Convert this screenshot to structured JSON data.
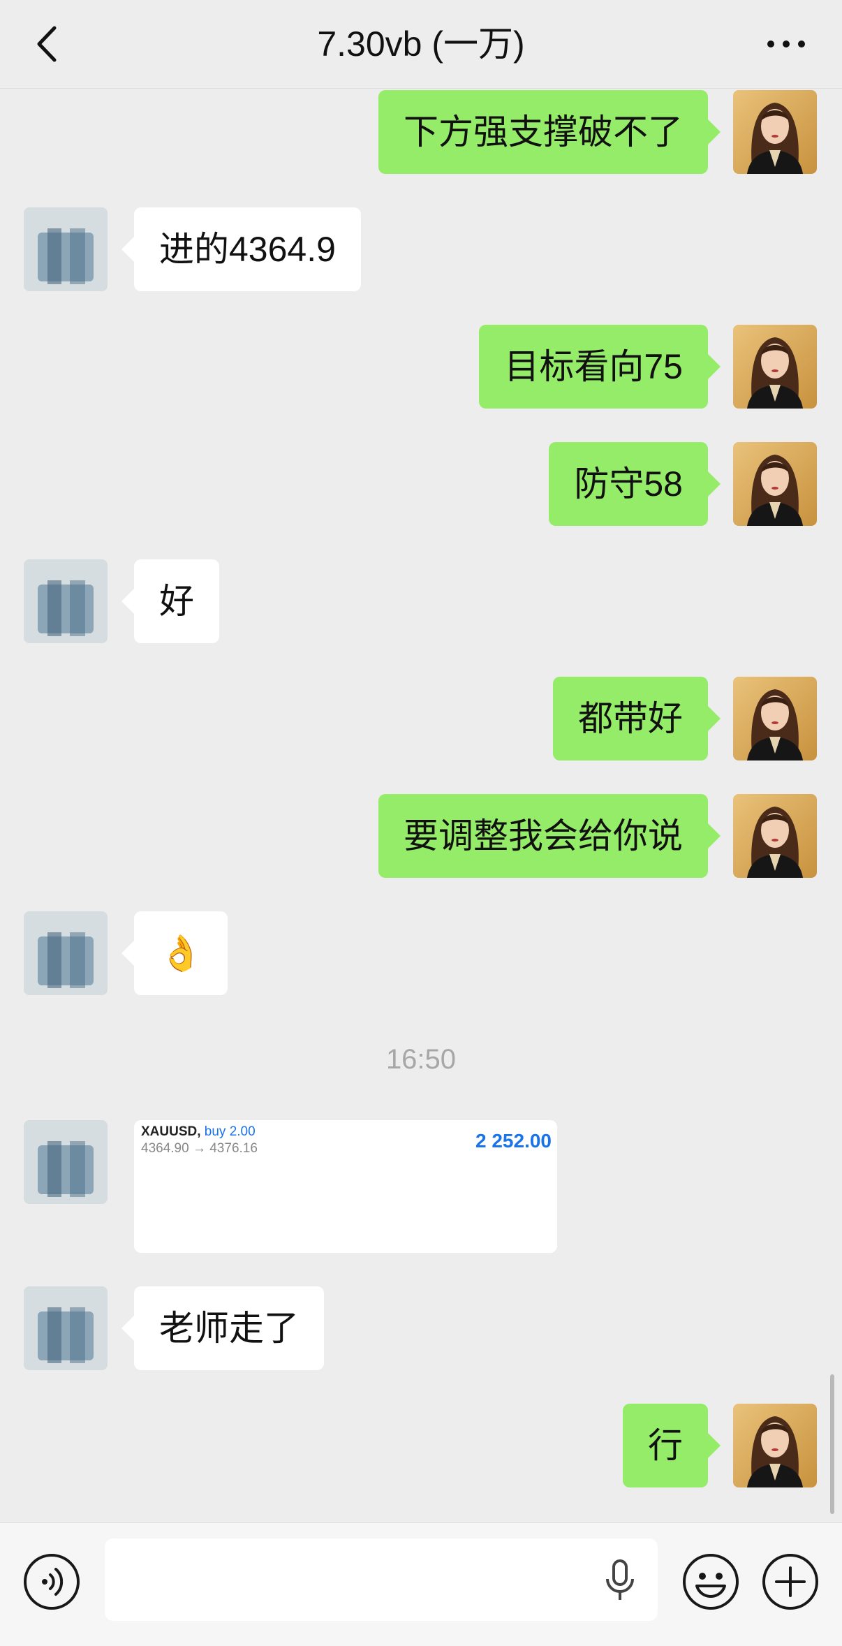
{
  "header": {
    "title": "7.30vb (一万)",
    "back_icon": "chevron-left-icon",
    "more_icon": "more-dots-icon"
  },
  "colors": {
    "background": "#ededed",
    "my_bubble": "#95ec69",
    "their_bubble": "#ffffff",
    "accent_blue": "#1a73e8",
    "timestamp": "#a7a7a7"
  },
  "messages": [
    {
      "side": "me",
      "text": "下方强支撑破不了"
    },
    {
      "side": "other",
      "text": "进的4364.9"
    },
    {
      "side": "me",
      "text": "目标看向75"
    },
    {
      "side": "me",
      "text": "防守58"
    },
    {
      "side": "other",
      "text": "好"
    },
    {
      "side": "me",
      "text": "都带好"
    },
    {
      "side": "me",
      "text": "要调整我会给你说"
    },
    {
      "side": "other",
      "text": "👌"
    },
    {
      "side": "other",
      "text": "老师走了"
    },
    {
      "side": "me",
      "text": "行"
    }
  ],
  "timestamp": "16:50",
  "trade_card": {
    "symbol": "XAUUSD,",
    "direction": "buy 2.00",
    "price_range": "4364.90 → 4376.16",
    "profit": "2 252.00"
  },
  "input_bar": {
    "voice_icon": "voice-mode-icon",
    "text_value": "",
    "mic_icon": "microphone-icon",
    "emoji_icon": "emoji-smile-icon",
    "plus_icon": "plus-circle-icon"
  }
}
